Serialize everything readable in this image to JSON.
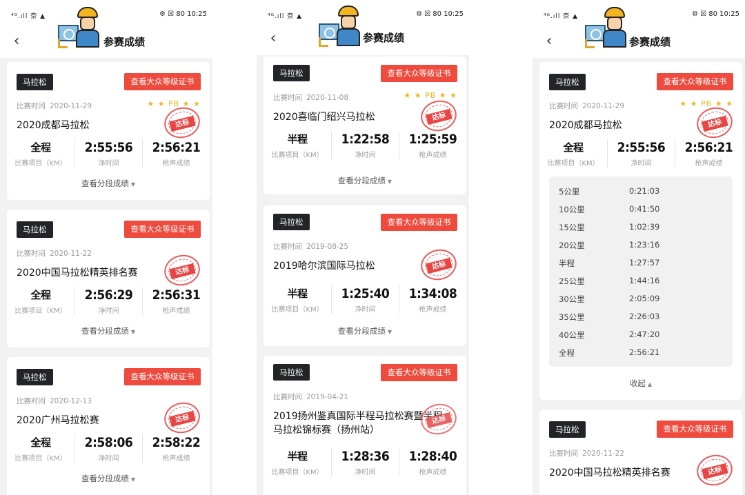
{
  "status": {
    "signal": "⁴ᴳ.ıll 奈 ▲",
    "right": "⚙ ☒ 80 10:25"
  },
  "nav": {
    "back_icon": "chevron-left-icon",
    "title": "参赛成绩"
  },
  "labels": {
    "tag": "马拉松",
    "cert": "查看大众等级证书",
    "date_prefix": "比赛时间",
    "pb": "★ ★ PB ★ ★",
    "stamp": "达标",
    "event_label": "比赛项目（KM）",
    "net_label": "净时间",
    "gun_label": "枪声成绩",
    "split_link": "查看分段成绩",
    "collapse": "收起"
  },
  "screen1": {
    "cards": [
      {
        "date": "2020-11-29",
        "pb": true,
        "name": "2020成都马拉松",
        "event": "全程",
        "net": "2:55:56",
        "gun": "2:56:21"
      },
      {
        "date": "2020-11-22",
        "pb": false,
        "name": "2020中国马拉松精英排名赛",
        "event": "全程",
        "net": "2:56:29",
        "gun": "2:56:31"
      },
      {
        "date": "2020-12-13",
        "pb": false,
        "name": "2020广州马拉松赛",
        "event": "全程",
        "net": "2:58:06",
        "gun": "2:58:22"
      }
    ]
  },
  "screen2": {
    "cards": [
      {
        "date": "2020-11-08",
        "pb": true,
        "name": "2020喜临门绍兴马拉松",
        "event": "半程",
        "net": "1:22:58",
        "gun": "1:25:59"
      },
      {
        "date": "2019-08-25",
        "pb": false,
        "name": "2019哈尔滨国际马拉松",
        "event": "半程",
        "net": "1:25:40",
        "gun": "1:34:08"
      },
      {
        "date": "2019-04-21",
        "pb": false,
        "name": "2019扬州鉴真国际半程马拉松赛暨半程马拉松锦标赛（扬州站）",
        "event": "半程",
        "net": "1:28:36",
        "gun": "1:28:40"
      }
    ]
  },
  "screen3": {
    "cards": [
      {
        "date": "2020-11-29",
        "pb": true,
        "name": "2020成都马拉松",
        "event": "全程",
        "net": "2:55:56",
        "gun": "2:56:21"
      },
      {
        "date": "2020-11-22",
        "pb": false,
        "name": "2020中国马拉松精英排名赛"
      }
    ],
    "splits": [
      {
        "d": "5公里",
        "t": "0:21:03"
      },
      {
        "d": "10公里",
        "t": "0:41:50"
      },
      {
        "d": "15公里",
        "t": "1:02:39"
      },
      {
        "d": "20公里",
        "t": "1:23:16"
      },
      {
        "d": "半程",
        "t": "1:27:57"
      },
      {
        "d": "25公里",
        "t": "1:44:16"
      },
      {
        "d": "30公里",
        "t": "2:05:09"
      },
      {
        "d": "35公里",
        "t": "2:26:03"
      },
      {
        "d": "40公里",
        "t": "2:47:20"
      },
      {
        "d": "全程",
        "t": "2:56:21"
      }
    ]
  },
  "colors": {
    "accent_red": "#ee4a3d",
    "tag_dark": "#222428",
    "pb_gold": "#f2b51f"
  }
}
